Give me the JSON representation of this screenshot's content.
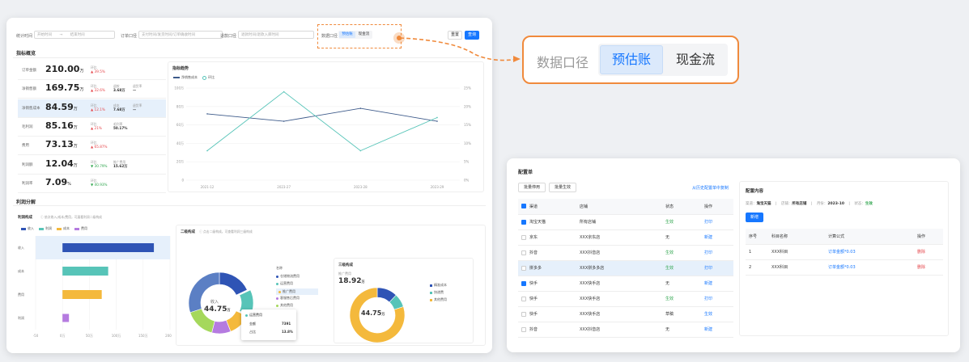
{
  "filters": {
    "stat_time_label": "统计时间",
    "stat_time_start": "开始时间",
    "stat_time_sep": "→",
    "stat_time_end": "结束时间",
    "order_label": "订单口径",
    "order_placeholder": "支付时间/发货时间/订单确收时间",
    "return_label": "退款口径",
    "return_placeholder": "退款时间/退款入库时间",
    "caliber_label": "数据口径",
    "caliber_tab_est": "预估账",
    "caliber_tab_cash": "现金流",
    "reset": "重置",
    "query": "查询"
  },
  "overview": {
    "title": "指标概览",
    "metrics": [
      {
        "label": "订单金额",
        "value": "210.00",
        "unit": "万",
        "cmp_label": "环比",
        "cmp": "▲ 39.5%",
        "cmp_dir": "up"
      },
      {
        "label": "净销售额",
        "value": "169.75",
        "unit": "万",
        "cmp_label": "环比",
        "cmp": "▲ 32.6%",
        "cmp_dir": "up",
        "extra1_label": "退款",
        "extra1": "3.68万",
        "extra2_label": "退货率",
        "extra2": "—"
      },
      {
        "label": "净销售成本",
        "value": "84.59",
        "unit": "万",
        "cmp_label": "环比",
        "cmp": "▲ 12.1%",
        "cmp_dir": "up",
        "extra1_label": "成本",
        "extra1": "7.68万",
        "extra2_label": "退货率",
        "extra2": "—"
      },
      {
        "label": "毛利润",
        "value": "85.16",
        "unit": "万",
        "cmp_label": "环比",
        "cmp": "▲ 21%",
        "cmp_dir": "up",
        "extra1_label": "毛利率",
        "extra1": "50.17%"
      },
      {
        "label": "费用",
        "value": "73.13",
        "unit": "万",
        "cmp_label": "环比",
        "cmp": "▲ 65.87%",
        "cmp_dir": "up"
      },
      {
        "label": "利润额",
        "value": "12.04",
        "unit": "万",
        "cmp_label": "环比",
        "cmp": "▼ 30.79%",
        "cmp_dir": "down",
        "extra1_label": "推广费用",
        "extra1": "15.62万"
      },
      {
        "label": "利润率",
        "value": "7.09",
        "unit": "%",
        "cmp_label": "环比",
        "cmp": "▼ 40.93%",
        "cmp_dir": "down"
      }
    ]
  },
  "trend": {
    "title": "指标趋势",
    "chart_data": {
      "type": "line",
      "x": [
        "2021-12",
        "2023-27",
        "2023-28",
        "2023-29"
      ],
      "series": [
        {
          "name": "净销售成本",
          "values": [
            72,
            64,
            78,
            64
          ],
          "color": "#3d5a8a",
          "axis": "left"
        },
        {
          "name": "环比",
          "values": [
            8,
            24,
            8,
            17
          ],
          "color": "#57c4b8",
          "axis": "right"
        }
      ],
      "y_left_ticks": [
        "0",
        "20万",
        "40万",
        "60万",
        "80万",
        "100万"
      ],
      "y_right_ticks": [
        "0%",
        "5%",
        "10%",
        "15%",
        "20%",
        "25%"
      ],
      "ylim_left": [
        0,
        100
      ],
      "ylim_right": [
        0,
        25
      ]
    }
  },
  "profit": {
    "title": "利润分解",
    "composition_title": "利润构成",
    "composition_hint": "依次收入/成本/费用，可展看利润二级构成",
    "bar_chart": {
      "type": "bar",
      "legend": [
        "收入",
        "利润",
        "成本",
        "费用"
      ],
      "colors": [
        "#2f54b5",
        "#57c4b8",
        "#f4b93c",
        "#b57be0"
      ],
      "categories": [
        "收入",
        "成本",
        "费用",
        "利润"
      ],
      "values": [
        170,
        85,
        73,
        12
      ],
      "x_ticks": [
        "-50",
        "0万",
        "50万",
        "100万",
        "150万",
        "200万"
      ],
      "xlim": [
        -50,
        200
      ]
    },
    "donut2": {
      "title": "二级构成",
      "hint": "点击二级构成，可查看利润三级构成",
      "center_label": "收入",
      "center_value": "44.75",
      "center_unit": "万",
      "chart_data": {
        "type": "pie",
        "values": [
          18,
          14,
          12,
          10,
          16,
          30
        ],
        "colors": [
          "#2f54b5",
          "#57c4b8",
          "#f4b93c",
          "#b57be0",
          "#a5d85c",
          "#5b7fc4"
        ]
      },
      "tree_title": "名称",
      "tree": [
        {
          "label": "仓储物流费用",
          "color": "#2f54b5"
        },
        {
          "label": "运营费用",
          "color": "#57c4b8"
        },
        {
          "label": "推广费用",
          "color": "#f4b93c"
        },
        {
          "label": "客服售后费用",
          "color": "#b57be0"
        },
        {
          "label": "其他费用",
          "color": "#a5d85c"
        }
      ],
      "tooltip_title": "运营费用",
      "tooltip_amount_label": "金额",
      "tooltip_amount": "7391",
      "tooltip_pct_label": "占比",
      "tooltip_pct": "13.8%"
    },
    "donut3": {
      "title": "三级构成",
      "sub_label": "推广费用",
      "sub_value": "18.92",
      "sub_unit": "万",
      "center_value": "44.75",
      "center_unit": "万",
      "legend": [
        "精准成本",
        "快递费",
        "其他费用"
      ],
      "chart_data": {
        "type": "pie",
        "values": [
          12,
          8,
          80
        ],
        "colors": [
          "#2f54b5",
          "#57c4b8",
          "#f4b93c"
        ]
      }
    }
  },
  "config": {
    "title": "配置单",
    "batch_disable": "批量停用",
    "batch_enable": "批量生效",
    "copy_link": "从历史配置单中复制",
    "columns": [
      "渠道",
      "店铺",
      "状态",
      "操作"
    ],
    "rows": [
      {
        "channel": "淘宝天猫",
        "shop": "所有店铺",
        "status": "生效",
        "action": "打印",
        "checked": true,
        "highlight": false
      },
      {
        "channel": "京东",
        "shop": "XXX京东店",
        "status": "无",
        "action": "新建",
        "checked": false,
        "highlight": false
      },
      {
        "channel": "抖音",
        "shop": "XXX抖音店",
        "status": "生效",
        "action": "打印",
        "checked": false,
        "highlight": false
      },
      {
        "channel": "拼多多",
        "shop": "XXX拼多多店",
        "status": "生效",
        "action": "打印",
        "checked": false,
        "highlight": true
      },
      {
        "channel": "快手",
        "shop": "XXX快手店",
        "status": "无",
        "action": "新建",
        "checked": true,
        "highlight": false
      },
      {
        "channel": "快手",
        "shop": "XXX快手店",
        "status": "生效",
        "action": "打印",
        "checked": false,
        "highlight": false
      },
      {
        "channel": "快手",
        "shop": "XXX快手店",
        "status": "草稿",
        "action": "生效",
        "checked": false,
        "highlight": false
      },
      {
        "channel": "抖音",
        "shop": "XXX抖音店",
        "status": "无",
        "action": "新建",
        "checked": false,
        "highlight": false
      }
    ],
    "content": {
      "title": "配置内容",
      "channel_label": "渠道：",
      "channel": "淘宝天猫",
      "shop_label": "店铺：",
      "shop": "所有店铺",
      "month_label": "月份：",
      "month": "2023-10",
      "status_label": "状态：",
      "status": "生效",
      "add": "新增",
      "columns": [
        "序号",
        "科目名称",
        "计算公式",
        "操作"
      ],
      "rows": [
        {
          "idx": "1",
          "name": "XXX科目",
          "formula": "订单金额*0.03",
          "action": "删除"
        },
        {
          "idx": "2",
          "name": "XXX科目",
          "formula": "订单金额*0.03",
          "action": "删除"
        }
      ]
    }
  }
}
